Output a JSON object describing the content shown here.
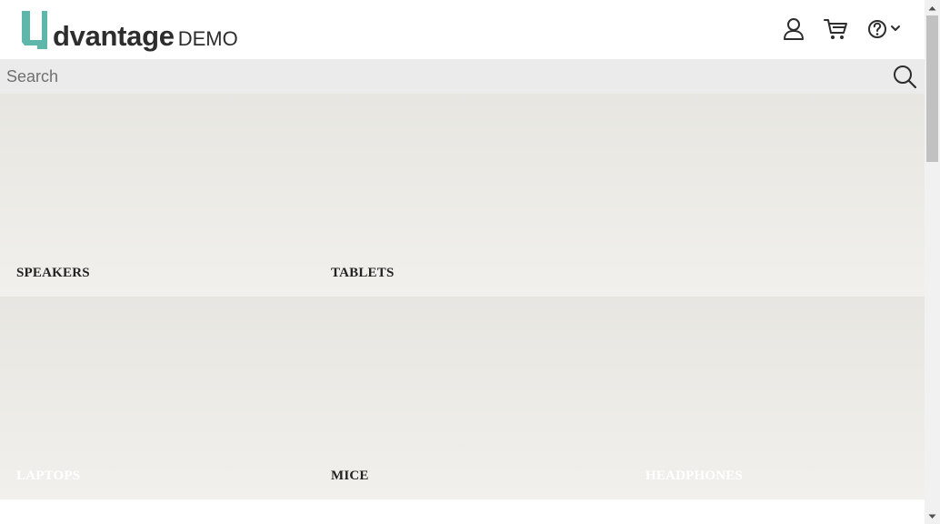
{
  "header": {
    "logo_word": "dvantage",
    "logo_suffix": "DEMO",
    "icons": {
      "user": "user-icon",
      "cart": "cart-icon",
      "help": "help-icon",
      "dropdown": "chevron-down-icon"
    }
  },
  "search": {
    "placeholder": "Search",
    "value": ""
  },
  "categories": [
    {
      "label": "SPEAKERS"
    },
    {
      "label": "TABLETS"
    },
    {
      "label": "LAPTOPS"
    },
    {
      "label": "MICE"
    },
    {
      "label": "HEADPHONES"
    }
  ],
  "colors": {
    "brand_teal": "#5fb7ab",
    "text_dark": "#2d2d2d",
    "search_bg": "#ebebeb",
    "tile_bg_top": "#e7e6e1",
    "tile_bg_bottom": "#f1f0ec"
  }
}
